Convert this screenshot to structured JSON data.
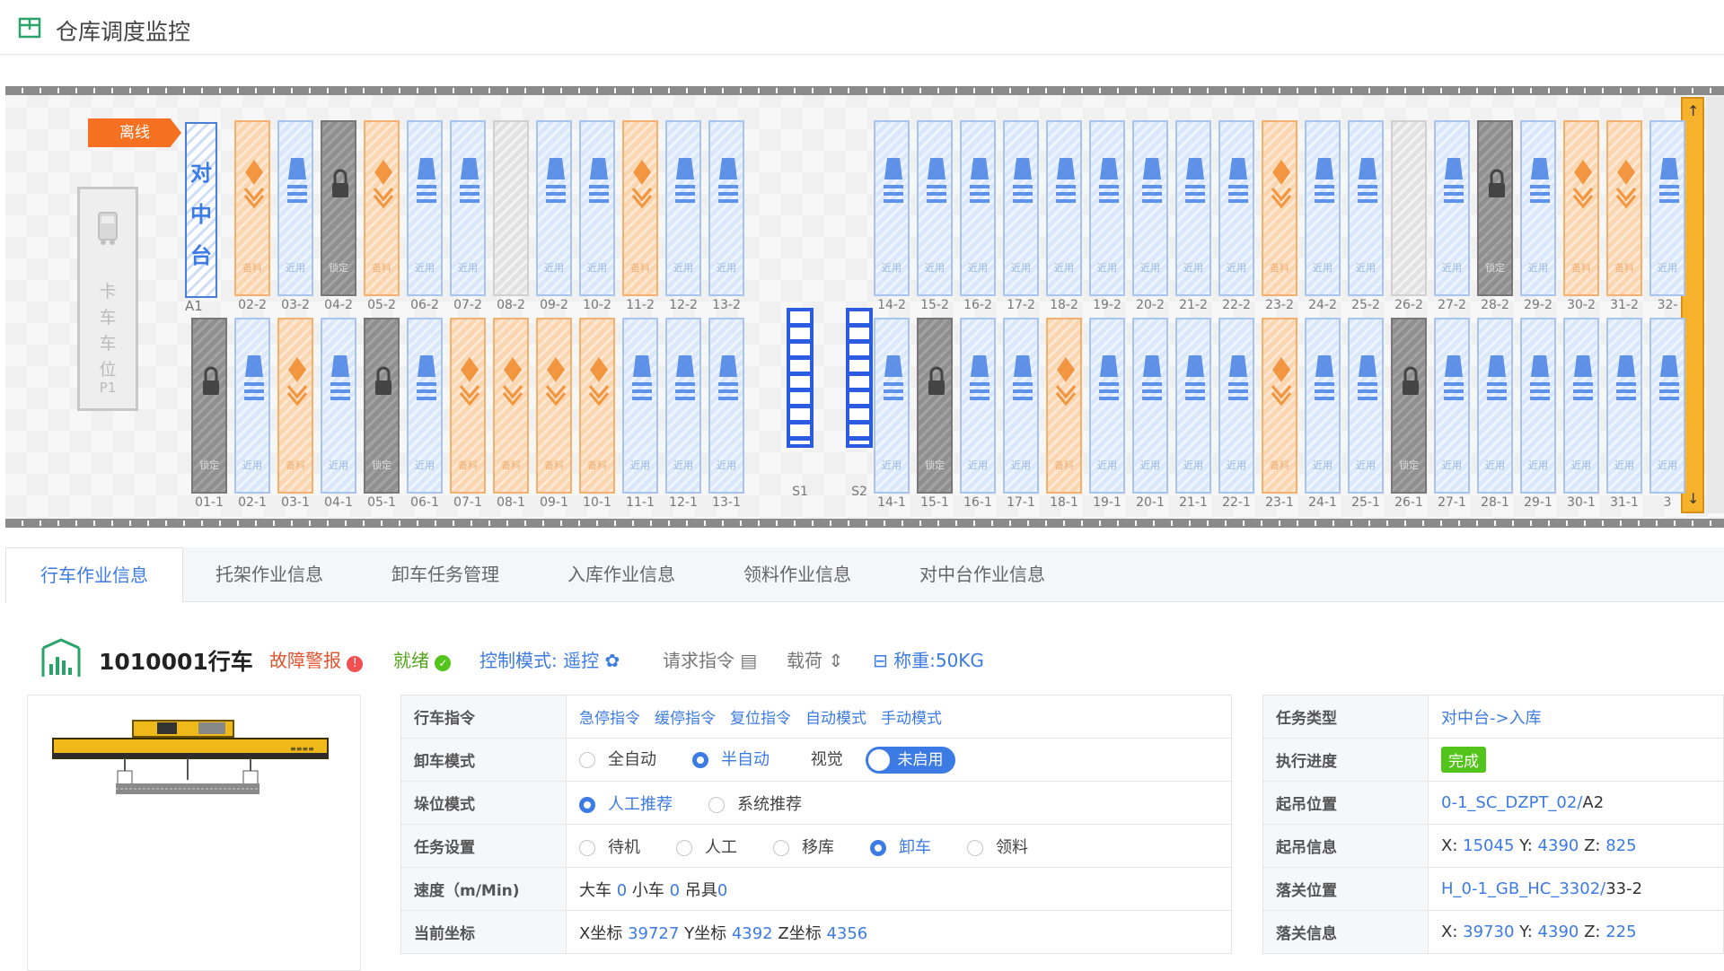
{
  "app": {
    "title": "仓库调度监控"
  },
  "map": {
    "offline_label": "离线",
    "truck": {
      "label": "卡车车位",
      "code": "P1"
    },
    "center_table": {
      "label": "对中台",
      "code": "A1"
    },
    "status_text": {
      "empty": "近用",
      "stock": "备料",
      "lock": "锁定"
    },
    "top_row": [
      {
        "code": "02-2",
        "state": "stock"
      },
      {
        "code": "03-2",
        "state": "empty"
      },
      {
        "code": "04-2",
        "state": "lock"
      },
      {
        "code": "05-2",
        "state": "stock"
      },
      {
        "code": "06-2",
        "state": "empty"
      },
      {
        "code": "07-2",
        "state": "empty"
      },
      {
        "code": "08-2",
        "state": "blank"
      },
      {
        "code": "09-2",
        "state": "empty"
      },
      {
        "code": "10-2",
        "state": "empty"
      },
      {
        "code": "11-2",
        "state": "stock"
      },
      {
        "code": "12-2",
        "state": "empty"
      },
      {
        "code": "13-2",
        "state": "empty"
      },
      {
        "code": "14-2",
        "state": "empty"
      },
      {
        "code": "15-2",
        "state": "empty"
      },
      {
        "code": "16-2",
        "state": "empty"
      },
      {
        "code": "17-2",
        "state": "empty"
      },
      {
        "code": "18-2",
        "state": "empty"
      },
      {
        "code": "19-2",
        "state": "empty"
      },
      {
        "code": "20-2",
        "state": "empty"
      },
      {
        "code": "21-2",
        "state": "empty"
      },
      {
        "code": "22-2",
        "state": "empty"
      },
      {
        "code": "23-2",
        "state": "stock"
      },
      {
        "code": "24-2",
        "state": "empty"
      },
      {
        "code": "25-2",
        "state": "empty"
      },
      {
        "code": "26-2",
        "state": "blank"
      },
      {
        "code": "27-2",
        "state": "empty"
      },
      {
        "code": "28-2",
        "state": "lock"
      },
      {
        "code": "29-2",
        "state": "empty"
      },
      {
        "code": "30-2",
        "state": "stock"
      },
      {
        "code": "31-2",
        "state": "stock"
      },
      {
        "code": "32-",
        "state": "empty"
      }
    ],
    "bottom_row": [
      {
        "code": "01-1",
        "state": "lock"
      },
      {
        "code": "02-1",
        "state": "empty"
      },
      {
        "code": "03-1",
        "state": "stock"
      },
      {
        "code": "04-1",
        "state": "empty"
      },
      {
        "code": "05-1",
        "state": "lock"
      },
      {
        "code": "06-1",
        "state": "empty"
      },
      {
        "code": "07-1",
        "state": "stock"
      },
      {
        "code": "08-1",
        "state": "stock"
      },
      {
        "code": "09-1",
        "state": "stock"
      },
      {
        "code": "10-1",
        "state": "stock"
      },
      {
        "code": "11-1",
        "state": "empty"
      },
      {
        "code": "12-1",
        "state": "empty"
      },
      {
        "code": "13-1",
        "state": "empty"
      },
      {
        "code": "14-1",
        "state": "empty"
      },
      {
        "code": "15-1",
        "state": "lock"
      },
      {
        "code": "16-1",
        "state": "empty"
      },
      {
        "code": "17-1",
        "state": "empty"
      },
      {
        "code": "18-1",
        "state": "stock"
      },
      {
        "code": "19-1",
        "state": "empty"
      },
      {
        "code": "20-1",
        "state": "empty"
      },
      {
        "code": "21-1",
        "state": "empty"
      },
      {
        "code": "22-1",
        "state": "empty"
      },
      {
        "code": "23-1",
        "state": "stock"
      },
      {
        "code": "24-1",
        "state": "empty"
      },
      {
        "code": "25-1",
        "state": "empty"
      },
      {
        "code": "26-1",
        "state": "lock"
      },
      {
        "code": "27-1",
        "state": "empty"
      },
      {
        "code": "28-1",
        "state": "empty"
      },
      {
        "code": "29-1",
        "state": "empty"
      },
      {
        "code": "30-1",
        "state": "empty"
      },
      {
        "code": "31-1",
        "state": "empty"
      },
      {
        "code": "3",
        "state": "empty"
      }
    ],
    "racks": [
      {
        "code": "S1"
      },
      {
        "code": "S2"
      }
    ],
    "colors": {
      "empty": "#dbe8fb",
      "stock": "#fad6b1",
      "lock": "#8f8f8f",
      "blank": "#e2e2e2",
      "accent": "#3d7be4",
      "offline": "#f57020"
    }
  },
  "tabs": [
    {
      "label": "行车作业信息",
      "active": true
    },
    {
      "label": "托架作业信息"
    },
    {
      "label": "卸车任务管理"
    },
    {
      "label": "入库作业信息"
    },
    {
      "label": "领料作业信息"
    },
    {
      "label": "对中台作业信息"
    }
  ],
  "device": {
    "name": "1010001行车",
    "fault": "故障警报",
    "ready": "就绪",
    "control_label": "控制模式:",
    "control_value": "遥控",
    "request": "请求指令",
    "load": "载荷",
    "weight": "称重:50KG"
  },
  "left_table": {
    "cmd_label": "行车指令",
    "commands": [
      "急停指令",
      "缓停指令",
      "复位指令",
      "自动模式",
      "手动模式"
    ],
    "unload_label": "卸车模式",
    "unload_options": [
      "全自动",
      "半自动"
    ],
    "unload_selected": "半自动",
    "vision_label": "视觉",
    "vision_toggle": "未启用",
    "stack_label": "垛位模式",
    "stack_options": [
      "人工推荐",
      "系统推荐"
    ],
    "stack_selected": "人工推荐",
    "task_label": "任务设置",
    "task_options": [
      "待机",
      "人工",
      "移库",
      "卸车",
      "领料"
    ],
    "task_selected": "卸车",
    "speed_label": "速度（m/Min)",
    "speed": {
      "big_label": "大车",
      "big": "0",
      "small_label": "小车",
      "small": "0",
      "spreader_label": "吊具",
      "spreader": "0"
    },
    "coord_label": "当前坐标",
    "coord": {
      "x_label": "X坐标",
      "x": "39727",
      "y_label": "Y坐标",
      "y": "4392",
      "z_label": "Z坐标",
      "z": "4356"
    }
  },
  "right_table": {
    "task_type_label": "任务类型",
    "task_type": "对中台->入库",
    "progress_label": "执行进度",
    "progress": "完成",
    "lift_pos_label": "起吊位置",
    "lift_pos_link": "0-1_SC_DZPT_02/",
    "lift_pos_suffix": "A2",
    "lift_info_label": "起吊信息",
    "lift_info": {
      "x": "15045",
      "y": "4390",
      "z": "825"
    },
    "drop_pos_label": "落关位置",
    "drop_pos_link": "H_0-1_GB_HC_3302/",
    "drop_pos_suffix": "33-2",
    "drop_info_label": "落关信息",
    "drop_info": {
      "x": "39730",
      "y": "4390",
      "z": "225"
    },
    "axis": {
      "x": "X:",
      "y": "Y:",
      "z": "Z:"
    }
  }
}
